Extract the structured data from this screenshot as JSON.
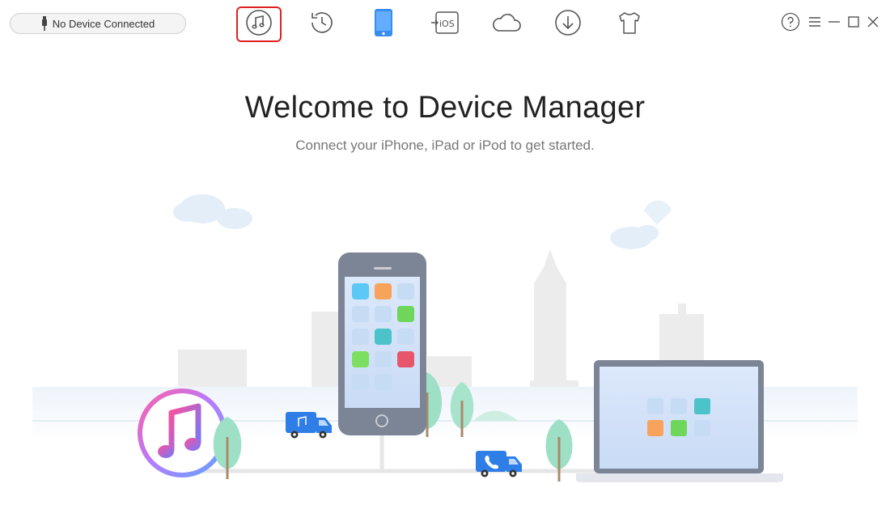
{
  "header": {
    "device_status": "No Device Connected"
  },
  "toolbar": {
    "items": [
      {
        "icon": "music-note-icon",
        "selected": true
      },
      {
        "icon": "history-backup-icon",
        "selected": false
      },
      {
        "icon": "phone-manager-icon",
        "selected": false
      },
      {
        "icon": "ios-transfer-icon",
        "selected": false
      },
      {
        "icon": "icloud-icon",
        "selected": false
      },
      {
        "icon": "download-icon",
        "selected": false
      },
      {
        "icon": "tshirt-icon",
        "selected": false
      }
    ],
    "ios_label": "iOS"
  },
  "window_controls": [
    "help-icon",
    "menu-icon",
    "minimize-icon",
    "maximize-icon",
    "close-icon"
  ],
  "main": {
    "title": "Welcome to Device Manager",
    "subtitle": "Connect your iPhone, iPad or iPod to get started."
  },
  "colors": {
    "accent_blue": "#3a8df0",
    "selection_red": "#e02020",
    "phone_body": "#7c8596",
    "tree_green": "#9ee0c6"
  }
}
